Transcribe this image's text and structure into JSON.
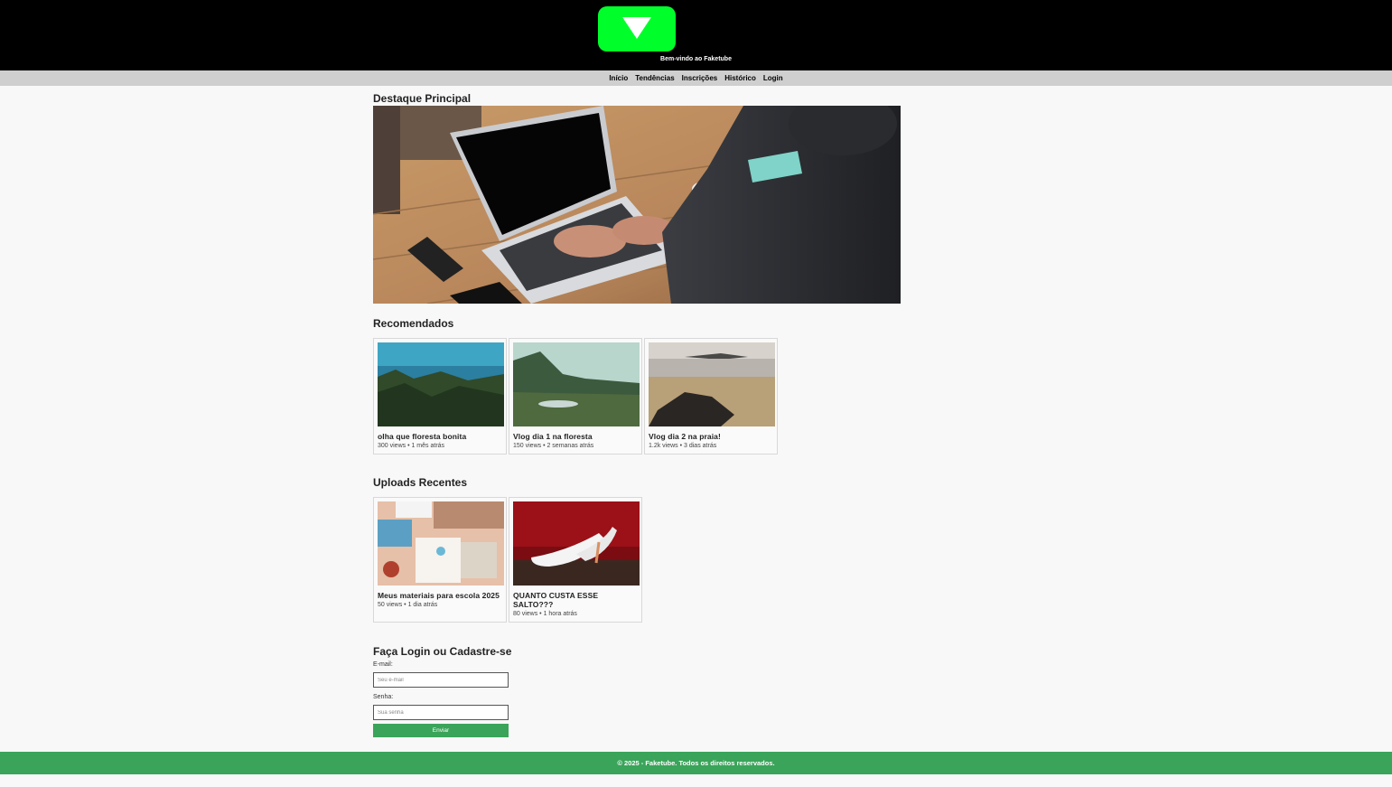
{
  "header": {
    "welcome": "Bem-vindo ao Faketube",
    "logo_icon": "play-triangle-logo-icon",
    "logo_color": "#00ff2a"
  },
  "nav": {
    "items": [
      "Início",
      "Tendências",
      "Inscrições",
      "Histórico",
      "Login"
    ]
  },
  "featured": {
    "title": "Destaque Principal"
  },
  "recommended": {
    "title": "Recomendados",
    "videos": [
      {
        "title": "olha que floresta bonita",
        "meta": "300 views • 1 mês atrás"
      },
      {
        "title": "Vlog dia 1 na floresta",
        "meta": "150 views • 2 semanas atrás"
      },
      {
        "title": "Vlog dia 2 na praia!",
        "meta": "1.2k views • 3 dias atrás"
      }
    ]
  },
  "recent": {
    "title": "Uploads Recentes",
    "videos": [
      {
        "title": "Meus materiais para escola 2025",
        "meta": "50 views • 1 dia atrás"
      },
      {
        "title": "QUANTO CUSTA ESSE SALTO???",
        "meta": "80 views • 1 hora atrás"
      }
    ]
  },
  "login": {
    "title": "Faça Login ou Cadastre-se",
    "email_label": "E-mail:",
    "email_placeholder": "Seu e-mail",
    "password_label": "Senha:",
    "password_placeholder": "Sua senha",
    "submit": "Enviar"
  },
  "footer": {
    "text": "© 2025 - Faketube. Todos os direitos reservados."
  },
  "colors": {
    "accent_green": "#3aa45a",
    "header_bg": "#000000",
    "nav_bg": "#cfcfcf"
  }
}
